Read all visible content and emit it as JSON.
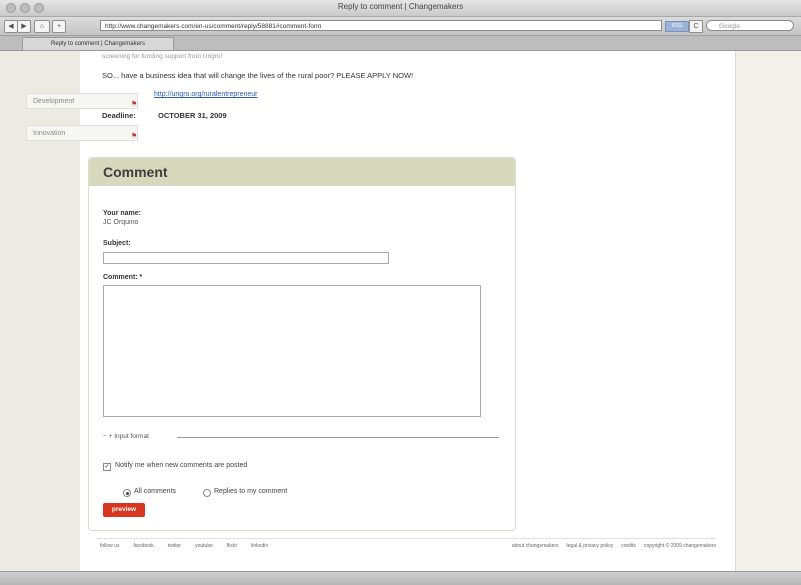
{
  "window": {
    "title": "Reply to comment | Changemakers"
  },
  "toolbar": {
    "back": "◀",
    "forward": "▶",
    "home": "⌂",
    "add": "+",
    "url": "http://www.changemakers.com/en-us/comment/reply/58881#comment-form",
    "rss": "RSS",
    "reload": "C",
    "search_placeholder": "Google"
  },
  "tab": {
    "label": "Reply to comment | Changemakers"
  },
  "teaser": {
    "line1": "screening for funding support from Ungro!",
    "line2": "SO... have a business idea that will change the lives of the rural poor? PLEASE APPLY NOW!",
    "link": "http://ungro.org/ruralentrepreneur",
    "deadline_label": "Deadline:",
    "deadline_value": "OCTOBER 31, 2009"
  },
  "sidetabs": [
    {
      "label": "Development"
    },
    {
      "label": "Innovation"
    }
  ],
  "comment_form": {
    "heading": "Comment",
    "your_name_label": "Your name:",
    "your_name_value": "JC Orquino",
    "subject_label": "Subject:",
    "subject_value": "",
    "comment_label": "Comment: *",
    "comment_value": "",
    "input_format_label": "+ Input format",
    "notify_label": "Notify me when new comments are posted",
    "notify_checked": true,
    "option_all": "All comments",
    "option_replies": "Replies to my comment",
    "selected_option": "all",
    "preview_label": "preview"
  },
  "footer": {
    "left_links": [
      "follow us",
      "facebook",
      "twitter",
      "youtube",
      "flickr",
      "linkedin"
    ],
    "right_links": [
      "about changemakers",
      "legal & privacy policy",
      "credits",
      "copyright © 2009 changemakers"
    ]
  },
  "colors": {
    "accent_head": "#d7d9bd",
    "preview_button": "#d8361e",
    "link": "#2a5db0"
  }
}
